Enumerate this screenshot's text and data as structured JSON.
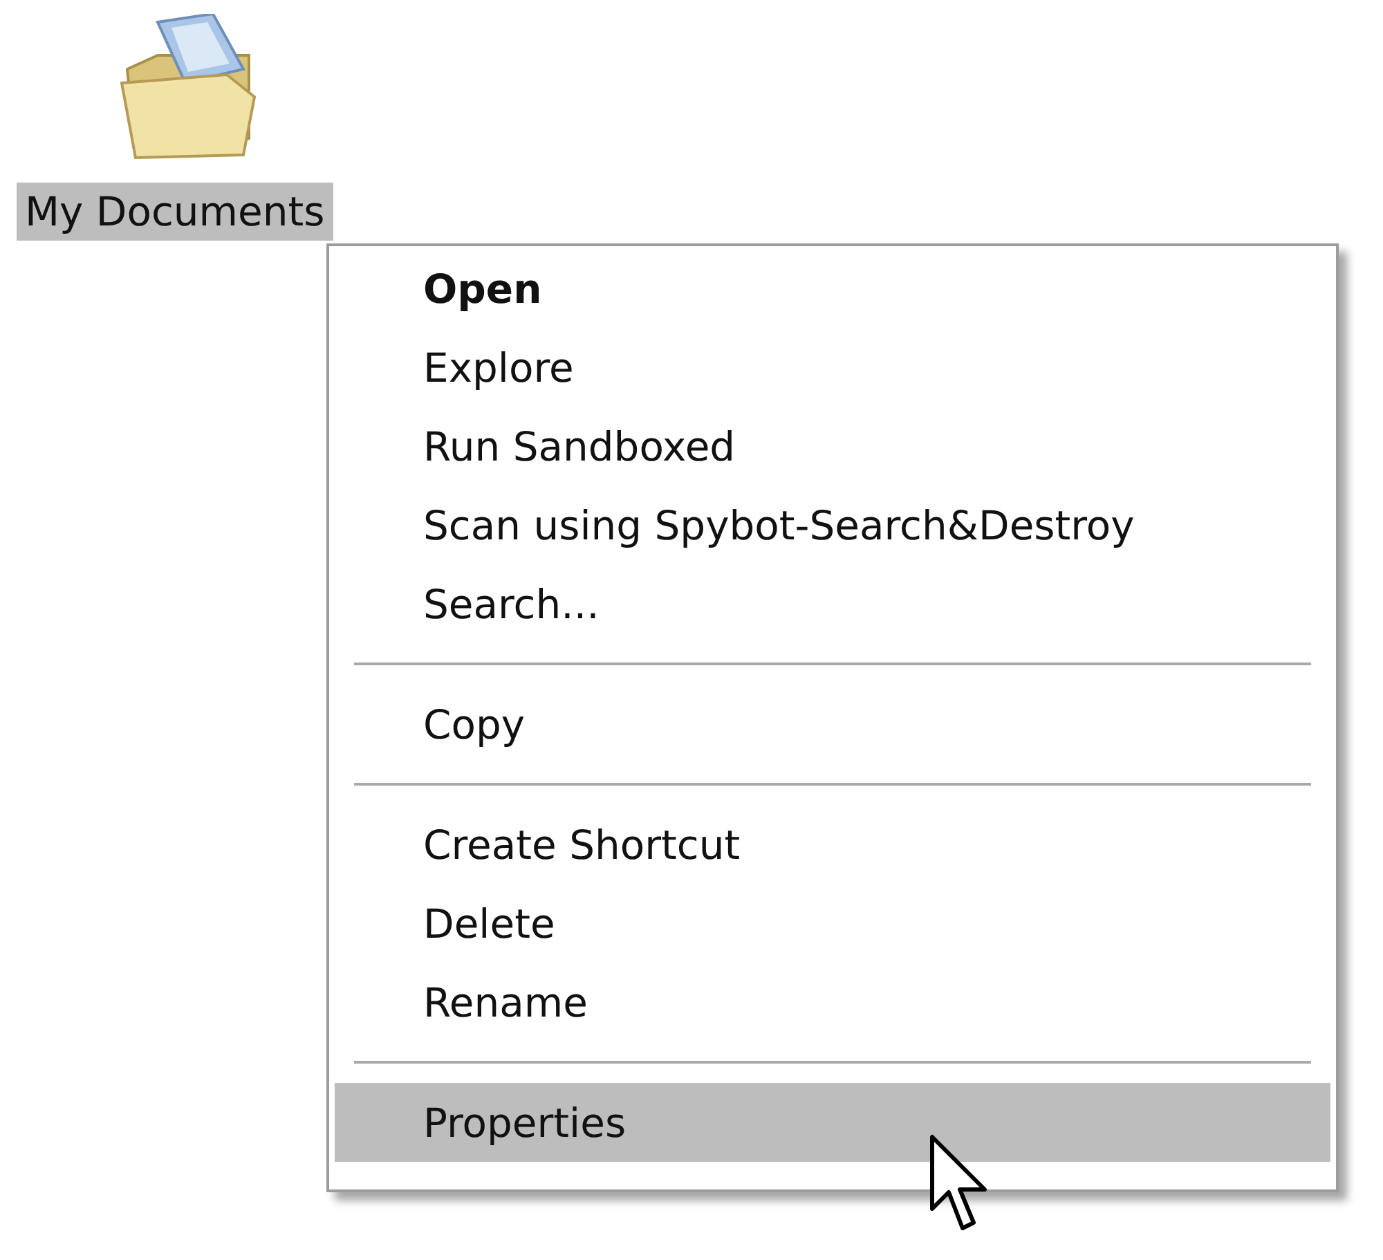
{
  "desktop_icon": {
    "label": "My Documents",
    "selected": true
  },
  "context_menu": {
    "items": [
      {
        "kind": "item",
        "label": "Open",
        "bold": true,
        "selected": false
      },
      {
        "kind": "item",
        "label": "Explore",
        "bold": false,
        "selected": false
      },
      {
        "kind": "item",
        "label": "Run Sandboxed",
        "bold": false,
        "selected": false
      },
      {
        "kind": "item",
        "label": "Scan using Spybot-Search&Destroy",
        "bold": false,
        "selected": false
      },
      {
        "kind": "item",
        "label": "Search...",
        "bold": false,
        "selected": false
      },
      {
        "kind": "separator"
      },
      {
        "kind": "item",
        "label": "Copy",
        "bold": false,
        "selected": false
      },
      {
        "kind": "separator"
      },
      {
        "kind": "item",
        "label": "Create Shortcut",
        "bold": false,
        "selected": false
      },
      {
        "kind": "item",
        "label": "Delete",
        "bold": false,
        "selected": false
      },
      {
        "kind": "item",
        "label": "Rename",
        "bold": false,
        "selected": false
      },
      {
        "kind": "separator"
      },
      {
        "kind": "item",
        "label": "Properties",
        "bold": false,
        "selected": true
      }
    ]
  }
}
